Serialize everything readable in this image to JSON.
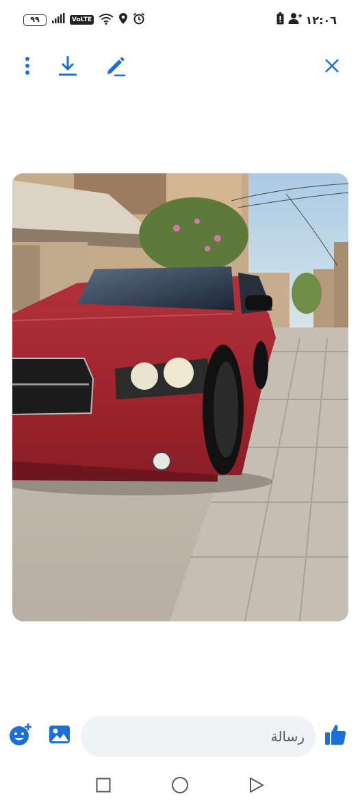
{
  "status_bar": {
    "battery_level": "٩٩",
    "network_badge": "VoLTE",
    "time": "١٢:٠٦",
    "icons": [
      "battery-icon",
      "signal-icon",
      "volte-icon",
      "wifi-icon",
      "location-icon",
      "alarm-icon",
      "phone-battery-icon",
      "user-add-icon"
    ]
  },
  "toolbar": {
    "icons": [
      "more-vertical-icon",
      "download-icon",
      "edit-icon",
      "close-icon"
    ],
    "accent_color": "#1a6fd8"
  },
  "photo": {
    "subject": "red-car-photo"
  },
  "composer": {
    "placeholder": "رسالة",
    "icons": [
      "add-emoji-icon",
      "gallery-icon",
      "thumbs-up-icon"
    ],
    "accent_color": "#1a6fd8"
  },
  "navbar": {
    "icons": [
      "recents-icon",
      "home-icon",
      "back-icon"
    ]
  }
}
